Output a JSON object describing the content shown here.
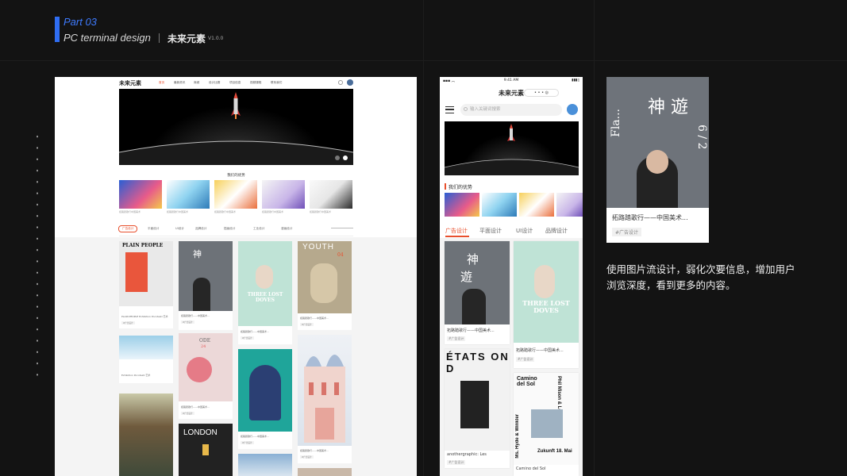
{
  "header": {
    "part": "Part 03",
    "subtitle": "PC terminal design",
    "brand": "未来元素",
    "version": "V1.0.0"
  },
  "pc": {
    "logo": "未来元素",
    "nav": [
      "首页",
      "最新资讯",
      "商城",
      "设计比赛",
      "项目信息",
      "视频课程",
      "联系我们"
    ],
    "active_nav": 0,
    "section_title": "我们的优势",
    "features": [
      {
        "text": "拓路踏歌行中国美术",
        "color": "#3a6fd8"
      },
      {
        "text": "拓路踏歌行中国美术",
        "color": "#4aa3d6"
      },
      {
        "text": "拓路踏歌行中国美术",
        "color": "#f0c24a"
      },
      {
        "text": "拓路踏歌行中国美术",
        "color": "#d9d6e8"
      },
      {
        "text": "拓路踏歌行中国美术",
        "color": "#e8e8e8"
      }
    ],
    "tabs": [
      "广告设计",
      "平面设计",
      "UI设计",
      "品牌设计",
      "插画设计",
      "工业设计",
      "漫画设计"
    ],
    "cards": [
      {
        "caption": "PLAIN PEOPLE Exhibition Pocotesti 艺术",
        "tag": "#广告设计",
        "title": "PLAIN PEOPLE"
      },
      {
        "caption": "拓路踏歌行——中国美术...",
        "tag": "#广告设计"
      },
      {
        "caption": "拓路踏歌行——中国美术...",
        "tag": "#广告设计",
        "title": "THREE LOST DOVES"
      },
      {
        "caption": "拓路踏歌行——中国美术...",
        "tag": "#广告设计",
        "title": "YOUTH",
        "number": "04"
      },
      {
        "caption": "Exhibition Pocotesti 艺术",
        "tag": "#广告设计"
      },
      {
        "caption": "拓路踏歌行——中国美术...",
        "tag": "#广告设计",
        "title": "ODE",
        "number": "24"
      },
      {
        "caption": "拓路踏歌行——中国美术...",
        "tag": "#广告设计"
      },
      {
        "caption": "拓路踏歌行——中国美术...",
        "tag": "#广告设计"
      },
      {
        "caption": "",
        "tag": "",
        "title": "LONDON"
      }
    ]
  },
  "mobile": {
    "status_time": "9:41 AM",
    "title": "未来元素",
    "search_placeholder": "输入关键词搜索",
    "section_title": "我们的优势",
    "tabs": [
      "广告设计",
      "平面设计",
      "UI设计",
      "品牌设计"
    ],
    "active_tab": 0,
    "cards": [
      {
        "caption": "拓路踏歌行——中国美术...",
        "tag": "#广告设计"
      },
      {
        "caption": "拓路踏歌行——中国美术...",
        "tag": "#广告设计",
        "title": "THREE LOST DOVES"
      },
      {
        "caption": "anothergraphic: Les",
        "tag": "#广告设计",
        "title": "ÉTATS ON D"
      },
      {
        "caption": "Camino del Sol",
        "tag": "",
        "title": "Camino del Sol",
        "extra": "Phil Mison & Lexx",
        "extra2": "Ms. Hyde & Winkler",
        "date": "Zukunft 18. Mai"
      }
    ]
  },
  "detail": {
    "caption": "拓路踏歌行——中国美术...",
    "tag": "#广告设计",
    "poster_chars": "神 遊",
    "poster_num": "6 / 2",
    "poster_side": "Fla..."
  },
  "description": "使用图片流设计，弱化次要信息，增加用户浏览深度，看到更多的内容。",
  "colors": {
    "accent_blue": "#2f6df2",
    "accent_orange": "#e8502e",
    "background": "#131313"
  }
}
